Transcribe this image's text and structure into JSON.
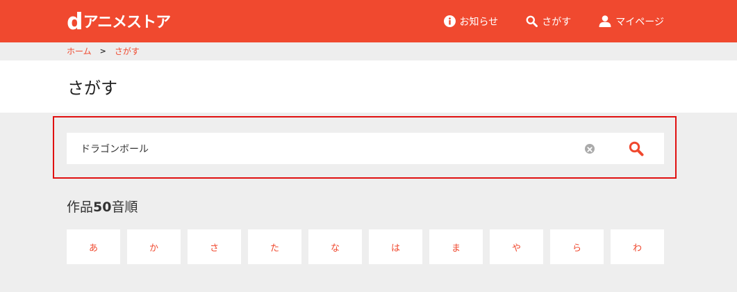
{
  "header": {
    "logo_d": "d",
    "logo_text": "アニメストア",
    "brand_color": "#f0492f",
    "nav": [
      {
        "label": "お知らせ",
        "icon": "info-icon"
      },
      {
        "label": "さがす",
        "icon": "search-icon"
      },
      {
        "label": "マイページ",
        "icon": "user-icon"
      }
    ]
  },
  "breadcrumb": {
    "home": "ホーム",
    "separator": ">",
    "current": "さがす"
  },
  "page": {
    "title": "さがす"
  },
  "search": {
    "value": "ドラゴンボール",
    "clear_icon": "clear-icon",
    "submit_icon": "search-icon"
  },
  "kana_section": {
    "title_prefix": "作品",
    "title_number": "50",
    "title_suffix": "音順",
    "items": [
      "あ",
      "か",
      "さ",
      "た",
      "な",
      "は",
      "ま",
      "や",
      "ら",
      "わ"
    ]
  }
}
